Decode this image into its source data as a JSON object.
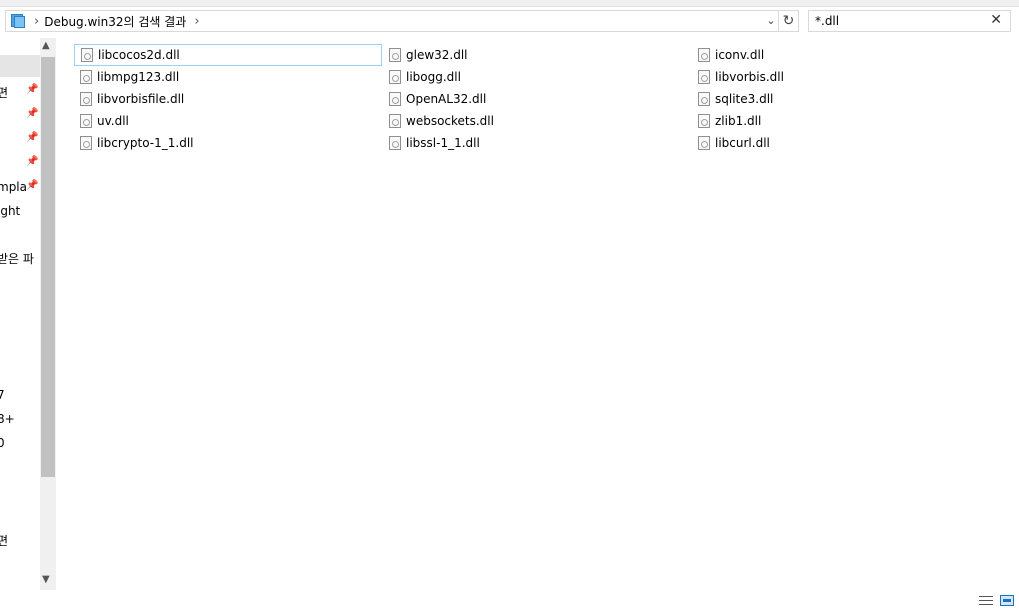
{
  "address": {
    "path": "Debug.win32의 검색 결과",
    "separator": "›"
  },
  "search": {
    "query": "*.dll"
  },
  "nav": {
    "items": [
      "편",
      "",
      "",
      "",
      "mpla",
      "ight",
      "받은 파",
      "7",
      "8+",
      "0",
      "",
      "편"
    ]
  },
  "files": [
    {
      "name": "libcocos2d.dll",
      "col": 0,
      "row": 0,
      "selected": true
    },
    {
      "name": "glew32.dll",
      "col": 1,
      "row": 0
    },
    {
      "name": "iconv.dll",
      "col": 2,
      "row": 0
    },
    {
      "name": "libmpg123.dll",
      "col": 0,
      "row": 1
    },
    {
      "name": "libogg.dll",
      "col": 1,
      "row": 1
    },
    {
      "name": "libvorbis.dll",
      "col": 2,
      "row": 1
    },
    {
      "name": "libvorbisfile.dll",
      "col": 0,
      "row": 2
    },
    {
      "name": "OpenAL32.dll",
      "col": 1,
      "row": 2
    },
    {
      "name": "sqlite3.dll",
      "col": 2,
      "row": 2
    },
    {
      "name": "uv.dll",
      "col": 0,
      "row": 3
    },
    {
      "name": "websockets.dll",
      "col": 1,
      "row": 3
    },
    {
      "name": "zlib1.dll",
      "col": 2,
      "row": 3
    },
    {
      "name": "libcrypto-1_1.dll",
      "col": 0,
      "row": 4
    },
    {
      "name": "libssl-1_1.dll",
      "col": 1,
      "row": 4
    },
    {
      "name": "libcurl.dll",
      "col": 2,
      "row": 4
    }
  ],
  "icons": {
    "dropdown": "chevron-down-icon",
    "refresh": "refresh-icon",
    "clear": "close-icon",
    "pin": "pin-icon",
    "file": "dll-file-icon"
  }
}
